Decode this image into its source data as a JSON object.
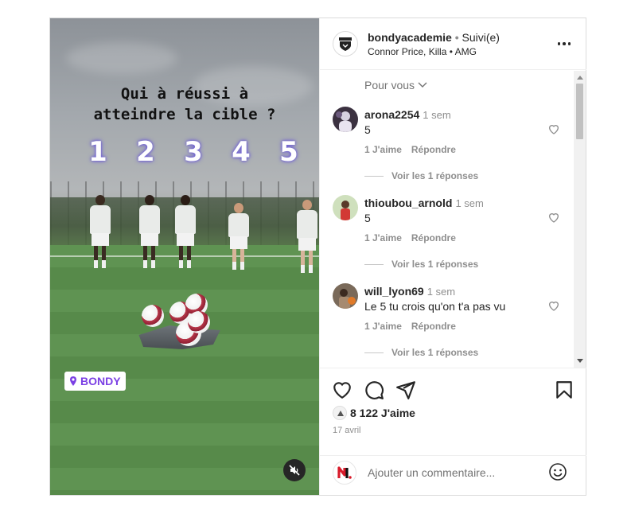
{
  "media": {
    "overlay_title_line1": "Qui à réussi à",
    "overlay_title_line2": "atteindre la cible ?",
    "numbers": [
      "1",
      "2",
      "3",
      "4",
      "5"
    ],
    "location_label": "BONDY",
    "number_glow_color": "#6b5bd6",
    "location_color": "#7b3fe4"
  },
  "header": {
    "username": "bondyacademie",
    "separator": "•",
    "follow_status": "Suivi(e)",
    "audio": "Connor Price, Killa • AMG"
  },
  "comments": {
    "sort_label": "Pour vous",
    "items": [
      {
        "user": "arona2254",
        "time": "1 sem",
        "text": "5",
        "like_label": "1 J'aime",
        "reply_label": "Répondre",
        "replies_label": "Voir les 1 réponses"
      },
      {
        "user": "thioubou_arnold",
        "time": "1 sem",
        "text": "5",
        "like_label": "1 J'aime",
        "reply_label": "Répondre",
        "replies_label": "Voir les 1 réponses"
      },
      {
        "user": "will_lyon69",
        "time": "1 sem",
        "text": "Le 5 tu crois qu'on t'a pas vu",
        "like_label": "1 J'aime",
        "reply_label": "Répondre",
        "replies_label": "Voir les 1 réponses"
      }
    ]
  },
  "actions": {
    "likes": "8 122 J'aime",
    "date": "17 avril"
  },
  "add_comment": {
    "placeholder": "Ajouter un commentaire..."
  },
  "icons": {
    "like": "heart-icon",
    "comment": "comment-bubble-icon",
    "share": "paper-plane-icon",
    "save": "bookmark-icon",
    "emoji": "emoji-icon",
    "mute": "speaker-muted-icon",
    "more": "more-options-icon",
    "location": "location-pin-icon"
  }
}
